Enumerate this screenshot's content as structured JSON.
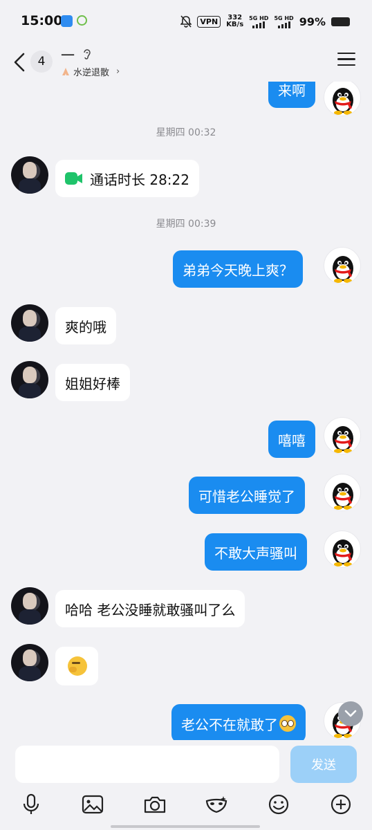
{
  "status_bar": {
    "time": "15:00",
    "vpn": "VPN",
    "net_speed_value": "332",
    "net_speed_unit": "KB/s",
    "signal1": "5G HD",
    "signal2": "5G HD",
    "battery": "99%"
  },
  "header": {
    "unread_count": "4",
    "contact_name": "一",
    "status_text": "水逆退散",
    "status_chevron": "›"
  },
  "messages": [
    {
      "type": "text",
      "side": "out",
      "text": "来啊"
    },
    {
      "type": "time",
      "text": "星期四 00:32"
    },
    {
      "type": "call",
      "side": "in",
      "text": "通话时长 28:22"
    },
    {
      "type": "time",
      "text": "星期四 00:39"
    },
    {
      "type": "text",
      "side": "out",
      "text": "弟弟今天晚上爽？"
    },
    {
      "type": "text",
      "side": "in",
      "text": "爽的哦"
    },
    {
      "type": "text",
      "side": "in",
      "text": "姐姐好棒"
    },
    {
      "type": "text",
      "side": "out",
      "text": "嘻嘻"
    },
    {
      "type": "text",
      "side": "out",
      "text": "可惜老公睡觉了"
    },
    {
      "type": "text",
      "side": "out",
      "text": "不敢大声骚叫"
    },
    {
      "type": "text",
      "side": "in",
      "text": "哈哈 老公没睡就敢骚叫了么"
    },
    {
      "type": "emoji",
      "side": "in",
      "emoji": "thinking-face-emoji"
    },
    {
      "type": "text",
      "side": "out",
      "text": "老公不在就敢了",
      "emoji": "pleading-face-emoji"
    }
  ],
  "input": {
    "value": "",
    "placeholder": "",
    "send_label": "发送"
  },
  "toolbar": [
    "microphone-icon",
    "image-icon",
    "camera-icon",
    "mask-icon",
    "smiley-icon",
    "plus-icon"
  ],
  "colors": {
    "outgoing_bubble": "#1a8cf0",
    "incoming_bubble": "#ffffff",
    "call_icon": "#1fc36a",
    "send_disabled": "#9cd0f8"
  }
}
